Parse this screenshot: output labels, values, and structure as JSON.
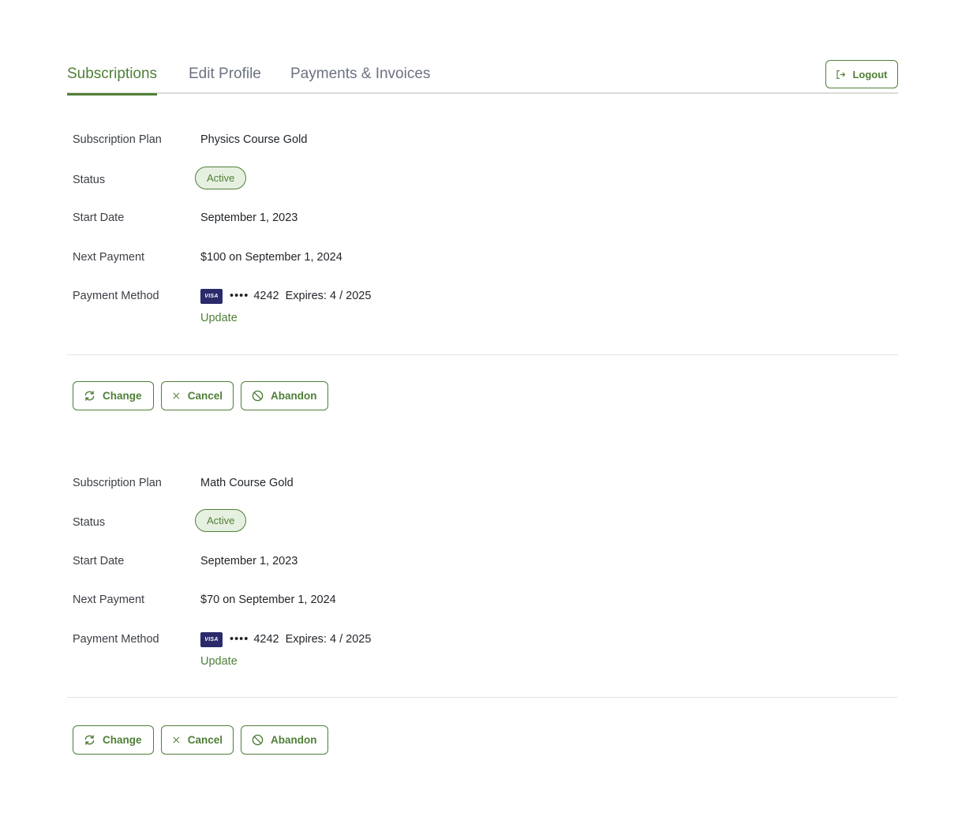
{
  "tabs": [
    {
      "label": "Subscriptions",
      "active": true
    },
    {
      "label": "Edit Profile",
      "active": false
    },
    {
      "label": "Payments & Invoices",
      "active": false
    }
  ],
  "logout_label": "Logout",
  "field_labels": {
    "plan": "Subscription Plan",
    "status": "Status",
    "start": "Start Date",
    "next": "Next Payment",
    "method": "Payment Method"
  },
  "card_brand": "VISA",
  "update_label": "Update",
  "actions": {
    "change": "Change",
    "cancel": "Cancel",
    "abandon": "Abandon"
  },
  "subscriptions": [
    {
      "plan": "Physics Course Gold",
      "status": "Active",
      "start_date": "September 1, 2023",
      "next_payment": "$100 on September 1, 2024",
      "card_dots": "••••",
      "card_last4": "4242",
      "card_expiry": "Expires: 4 / 2025"
    },
    {
      "plan": "Math Course Gold",
      "status": "Active",
      "start_date": "September 1, 2023",
      "next_payment": "$70 on September 1, 2024",
      "card_dots": "••••",
      "card_last4": "4242",
      "card_expiry": "Expires: 4 / 2025"
    }
  ],
  "colors": {
    "accent": "#4f7f37",
    "badge_bg": "#e6f0e0",
    "visa": "#2b2a6b"
  }
}
